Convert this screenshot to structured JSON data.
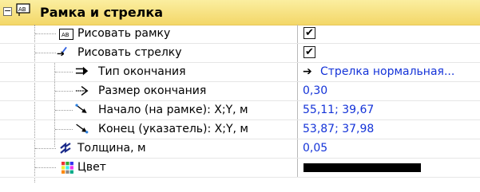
{
  "group": {
    "title": "Рамка и стрелка",
    "collapse_glyph": "−"
  },
  "rows": [
    {
      "label": "Рисовать рамку",
      "icon": "frame-text-icon",
      "value_type": "checkbox",
      "checked": true,
      "check_glyph": "✔"
    },
    {
      "label": "Рисовать стрелку",
      "icon": "arrow-draw-icon",
      "value_type": "checkbox",
      "checked": true,
      "check_glyph": "✔"
    },
    {
      "label": "Тип окончания",
      "icon": "arrow-end-type-icon",
      "value_type": "text",
      "value": "Стрелка нормальная...",
      "value_glyph": "➔"
    },
    {
      "label": "Размер окончания",
      "icon": "arrow-end-size-icon",
      "value_type": "text",
      "value": "0,30"
    },
    {
      "label": "Начало (на рамке): X;Y, м",
      "icon": "arrow-start-point-icon",
      "value_type": "text",
      "value": "55,11; 39,67"
    },
    {
      "label": "Конец (указатель): X;Y, м",
      "icon": "arrow-end-point-icon",
      "value_type": "text",
      "value": "53,87; 37,98"
    },
    {
      "label": "Толщина, м",
      "icon": "line-thickness-icon",
      "value_type": "text",
      "value": "0,05"
    },
    {
      "label": "Цвет",
      "icon": "color-palette-icon",
      "value_type": "color",
      "value_color": "#000000"
    }
  ],
  "colors": {
    "value_text": "#1433d8",
    "header_top": "#fbeea0",
    "header_bottom": "#f3d768"
  }
}
